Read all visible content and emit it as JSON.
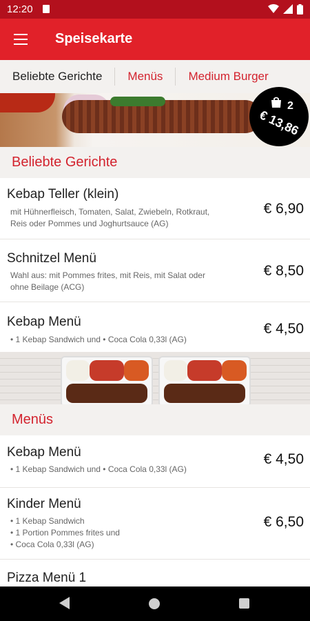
{
  "status": {
    "time": "12:20"
  },
  "appbar": {
    "title": "Speisekarte"
  },
  "tabs": [
    {
      "label": "Beliebte Gerichte",
      "active": true
    },
    {
      "label": "Menüs",
      "active": false
    },
    {
      "label": "Medium Burger",
      "active": false
    }
  ],
  "basket": {
    "count": "2",
    "price": "€ 13,86"
  },
  "sections": [
    {
      "title": "Beliebte Gerichte"
    },
    {
      "title": "Menüs"
    }
  ],
  "items_popular": [
    {
      "name": "Kebap Teller (klein)",
      "desc_lines": [
        "mit Hühnerfleisch, Tomaten, Salat, Zwiebeln, Rotkraut,",
        "Reis oder Pommes und Joghurtsauce (AG)"
      ],
      "price": "€ 6,90"
    },
    {
      "name": "Schnitzel Menü",
      "desc_lines": [
        "Wahl aus: mit Pommes frites, mit Reis, mit Salat oder",
        "ohne Beilage (ACG)"
      ],
      "price": "€ 8,50"
    },
    {
      "name": "Kebap Menü",
      "desc_lines": [
        "• 1 Kebap Sandwich und    • Coca Cola 0,33l  (AG)"
      ],
      "price": "€ 4,50"
    }
  ],
  "items_menus": [
    {
      "name": "Kebap Menü",
      "desc_lines": [
        "• 1 Kebap Sandwich und    • Coca Cola 0,33l  (AG)"
      ],
      "price": "€ 4,50"
    },
    {
      "name": "Kinder Menü",
      "desc_lines": [
        "• 1 Kebap Sandwich",
        "• 1 Portion Pommes frites und",
        "• Coca Cola 0,33l  (AG)"
      ],
      "price": "€ 6,50"
    },
    {
      "name": "Pizza Menü 1"
    }
  ]
}
